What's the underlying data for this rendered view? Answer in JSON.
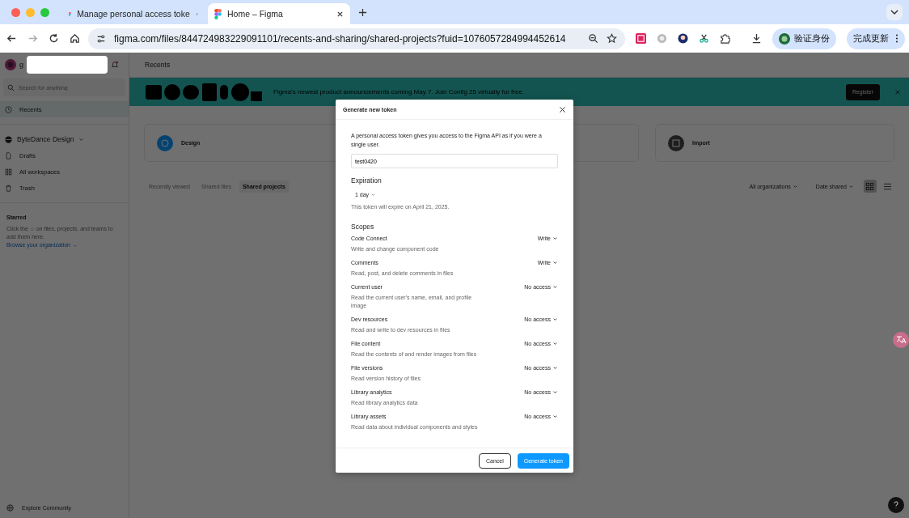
{
  "browser": {
    "tabs": [
      {
        "title": "Manage personal access toke",
        "selected": false
      },
      {
        "title": "Home – Figma",
        "selected": true
      }
    ],
    "url": "figma.com/files/844724983229091101/recents-and-sharing/shared-projects?fuid=1076057284994452614",
    "verify_button": "验证身份",
    "update_button": "完成更新"
  },
  "sidebar": {
    "user_initial": "g",
    "search": {
      "placeholder": "Search for anything"
    },
    "nav": [
      {
        "label": "Recents",
        "selected": true
      }
    ],
    "team": "ByteDance Design",
    "team_items": [
      {
        "label": "Drafts",
        "kind": "file"
      },
      {
        "label": "All workspaces",
        "kind": "grid"
      },
      {
        "label": "Trash",
        "kind": "trash"
      }
    ],
    "starred": {
      "title": "Starred",
      "text": "Click the ☆ on files, projects, and teams to add them here.",
      "link": "Browse your organization →"
    },
    "footer": "Explore Community"
  },
  "main": {
    "header": "Recents",
    "banner": {
      "text": "Figma's newest product announcements coming May 7. Join Config 25 virtually for free.",
      "button": "Register"
    },
    "cards": [
      {
        "label": "Design",
        "kind": "design"
      },
      {
        "kind": "hidden"
      },
      {
        "label": "Import",
        "kind": "import"
      }
    ],
    "tabs": [
      {
        "label": "Recently viewed",
        "selected": false
      },
      {
        "label": "Shared files",
        "selected": false
      },
      {
        "label": "Shared projects",
        "selected": true
      }
    ],
    "filters": [
      "All organizations",
      "Date shared"
    ],
    "views": [
      {
        "kind": "grid",
        "selected": true
      },
      {
        "kind": "list",
        "selected": false
      }
    ]
  },
  "modal": {
    "title": "Generate new token",
    "intro": "A personal access token gives you access to the Figma API as if you were a single user.",
    "name_value": "test0420",
    "expiration_label": "Expiration",
    "expiration_value": "1 day",
    "expiry_note": "This token will expire on April 21, 2025.",
    "scopes_title": "Scopes",
    "scopes": [
      {
        "name": "Code Connect",
        "description": "Write and change component code",
        "access": "Write"
      },
      {
        "name": "Comments",
        "description": "Read, post, and delete comments in files",
        "access": "Write"
      },
      {
        "name": "Current user",
        "description": "Read the current user's name, email, and profile image",
        "access": "No access"
      },
      {
        "name": "Dev resources",
        "description": "Read and write to dev resources in files",
        "access": "No access"
      },
      {
        "name": "File content",
        "description": "Read the contents of and render images from files",
        "access": "No access"
      },
      {
        "name": "File versions",
        "description": "Read version history of files",
        "access": "No access"
      },
      {
        "name": "Library analytics",
        "description": "Read library analytics data",
        "access": "No access"
      },
      {
        "name": "Library assets",
        "description": "Read data about individual components and styles",
        "access": "No access"
      }
    ],
    "cancel": "Cancel",
    "generate": "Generate token"
  }
}
